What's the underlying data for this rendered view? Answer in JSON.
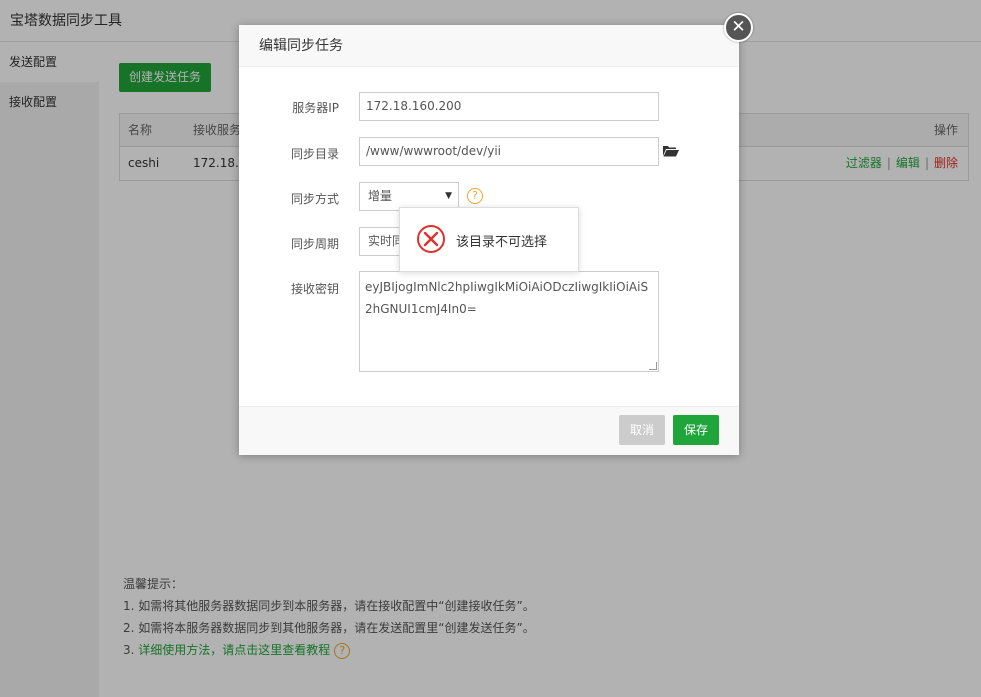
{
  "app": {
    "title": "宝塔数据同步工具",
    "sidebar": [
      {
        "label": "发送配置"
      },
      {
        "label": "接收配置"
      }
    ],
    "create_button": "创建发送任务",
    "table": {
      "headers": {
        "name": "名称",
        "server": "接收服务",
        "ops": "操作"
      },
      "rows": [
        {
          "name": "ceshi",
          "server": "172.18.1",
          "filter": "过滤器",
          "edit": "编辑",
          "delete": "删除",
          "sep": "|"
        }
      ]
    },
    "tips": {
      "title": "温馨提示：",
      "line1": "1. 如需将其他服务器数据同步到本服务器，请在接收配置中“创建接收任务”。",
      "line2": "2. 如需将本服务器数据同步到其他服务器，请在发送配置里“创建发送任务”。",
      "line3_prefix": "3. ",
      "line3_link": "详细使用方法，请点击这里查看教程"
    }
  },
  "dialog": {
    "title": "编辑同步任务",
    "close_glyph": "✕",
    "fields": {
      "server_ip": {
        "label": "服务器IP",
        "value": "172.18.160.200"
      },
      "sync_dir": {
        "label": "同步目录",
        "value": "/www/wwwroot/dev/yii"
      },
      "sync_mode": {
        "label": "同步方式",
        "value": "增量"
      },
      "sync_period": {
        "label": "同步周期",
        "value": "实时同"
      },
      "recv_key": {
        "label": "接收密钥",
        "value": "eyJBIjogImNlc2hpIiwgIkMiOiAiODczIiwgIkIiOiAiS2hGNUI1cmJ4In0="
      }
    },
    "help_glyph": "?",
    "cancel": "取消",
    "save": "保存"
  },
  "toast": {
    "message": "该目录不可选择"
  },
  "colors": {
    "accent": "#20a53a",
    "danger": "#e0302b",
    "warning": "#e8a82b"
  }
}
